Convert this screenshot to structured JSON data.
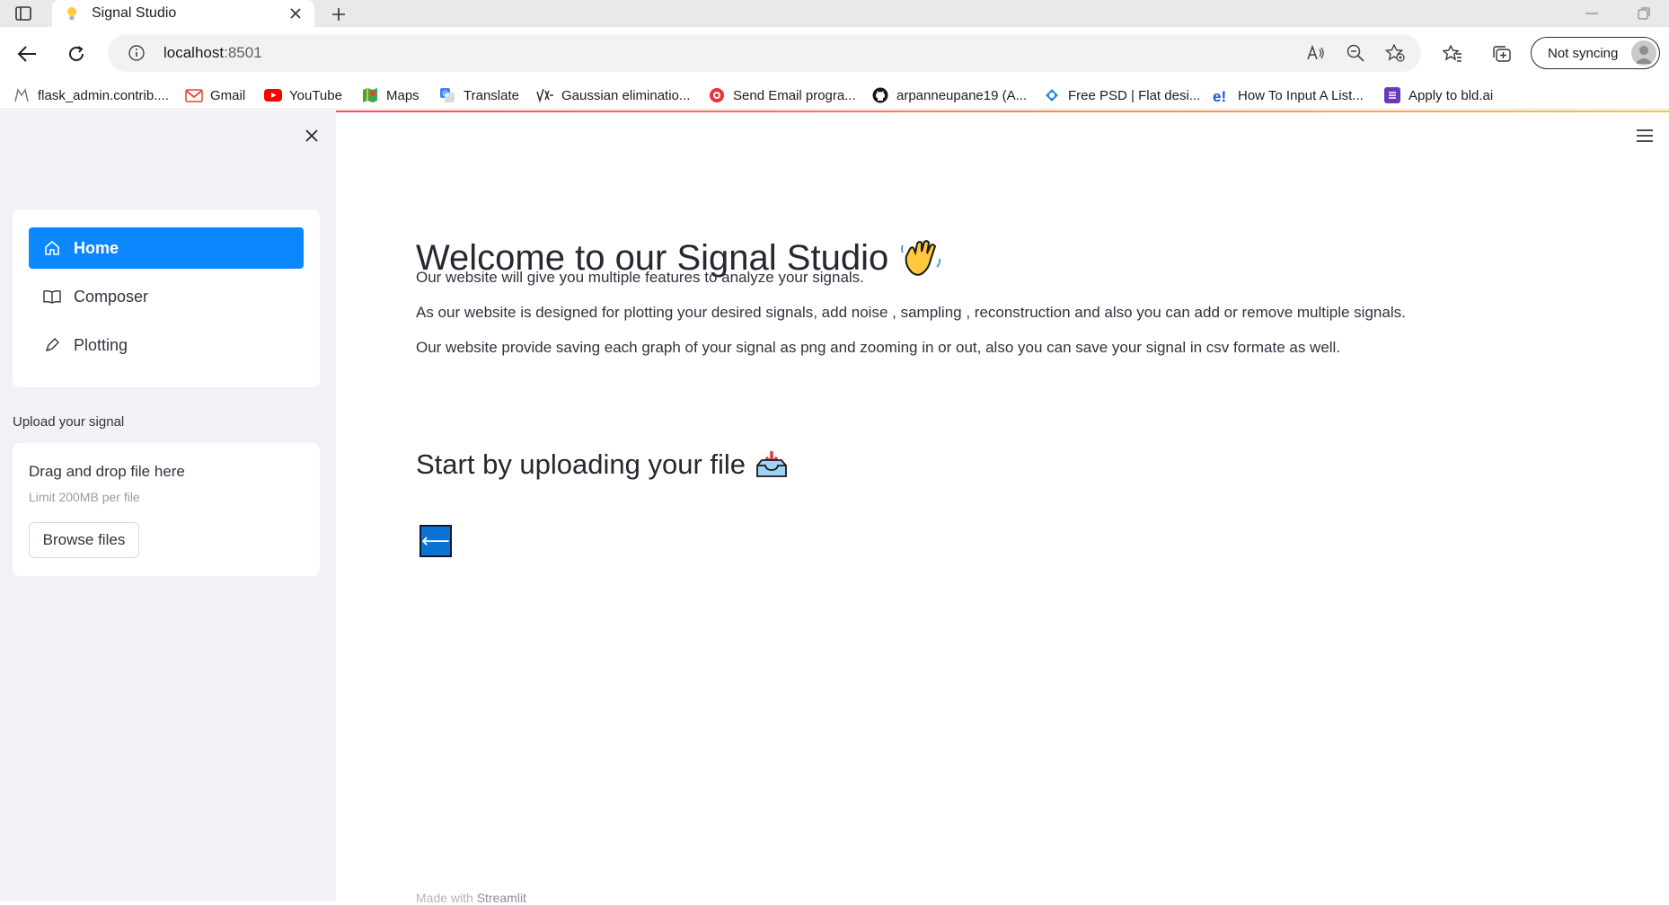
{
  "browser": {
    "tab_title": "Signal Studio",
    "url_host": "localhost",
    "url_port": ":8501",
    "sync_label": "Not syncing"
  },
  "bookmarks": [
    {
      "label": "flask_admin.contrib....",
      "icon": "flask-icon"
    },
    {
      "label": "Gmail",
      "icon": "gmail-icon"
    },
    {
      "label": "YouTube",
      "icon": "youtube-icon"
    },
    {
      "label": "Maps",
      "icon": "maps-icon"
    },
    {
      "label": "Translate",
      "icon": "translate-icon"
    },
    {
      "label": "Gaussian eliminatio...",
      "icon": "math-icon"
    },
    {
      "label": "Send Email progra...",
      "icon": "email-icon"
    },
    {
      "label": "arpanneupane19 (A...",
      "icon": "github-icon"
    },
    {
      "label": "Free PSD | Flat desi...",
      "icon": "freepik-icon"
    },
    {
      "label": "How To Input A List...",
      "icon": "educative-icon"
    },
    {
      "label": "Apply to bld.ai",
      "icon": "form-icon"
    }
  ],
  "sidebar": {
    "nav": [
      {
        "label": "Home",
        "icon": "home-icon",
        "active": true
      },
      {
        "label": "Composer",
        "icon": "book-icon",
        "active": false
      },
      {
        "label": "Plotting",
        "icon": "pen-icon",
        "active": false
      }
    ],
    "upload_label": "Upload your signal",
    "drop_title": "Drag and drop file here",
    "drop_limit": "Limit 200MB per file",
    "browse_label": "Browse files"
  },
  "main": {
    "title": "Welcome to our Signal Studio",
    "paragraphs": [
      "Our website will give you multiple features to analyze your signals.",
      "As our website is designed for plotting your desired signals, add noise , sampling , reconstruction and also you can add or remove multiple signals.",
      "Our website provide saving each graph of your signal as png and zooming in or out, also you can save your signal in csv formate as well."
    ],
    "subtitle": "Start by uploading your file",
    "back_symbol": "⟵",
    "footer_prefix": "Made with ",
    "footer_brand": "Streamlit"
  },
  "colors": {
    "accent": "#0b87ff",
    "sidebar_bg": "#f0f2f6",
    "text": "#31333f"
  }
}
